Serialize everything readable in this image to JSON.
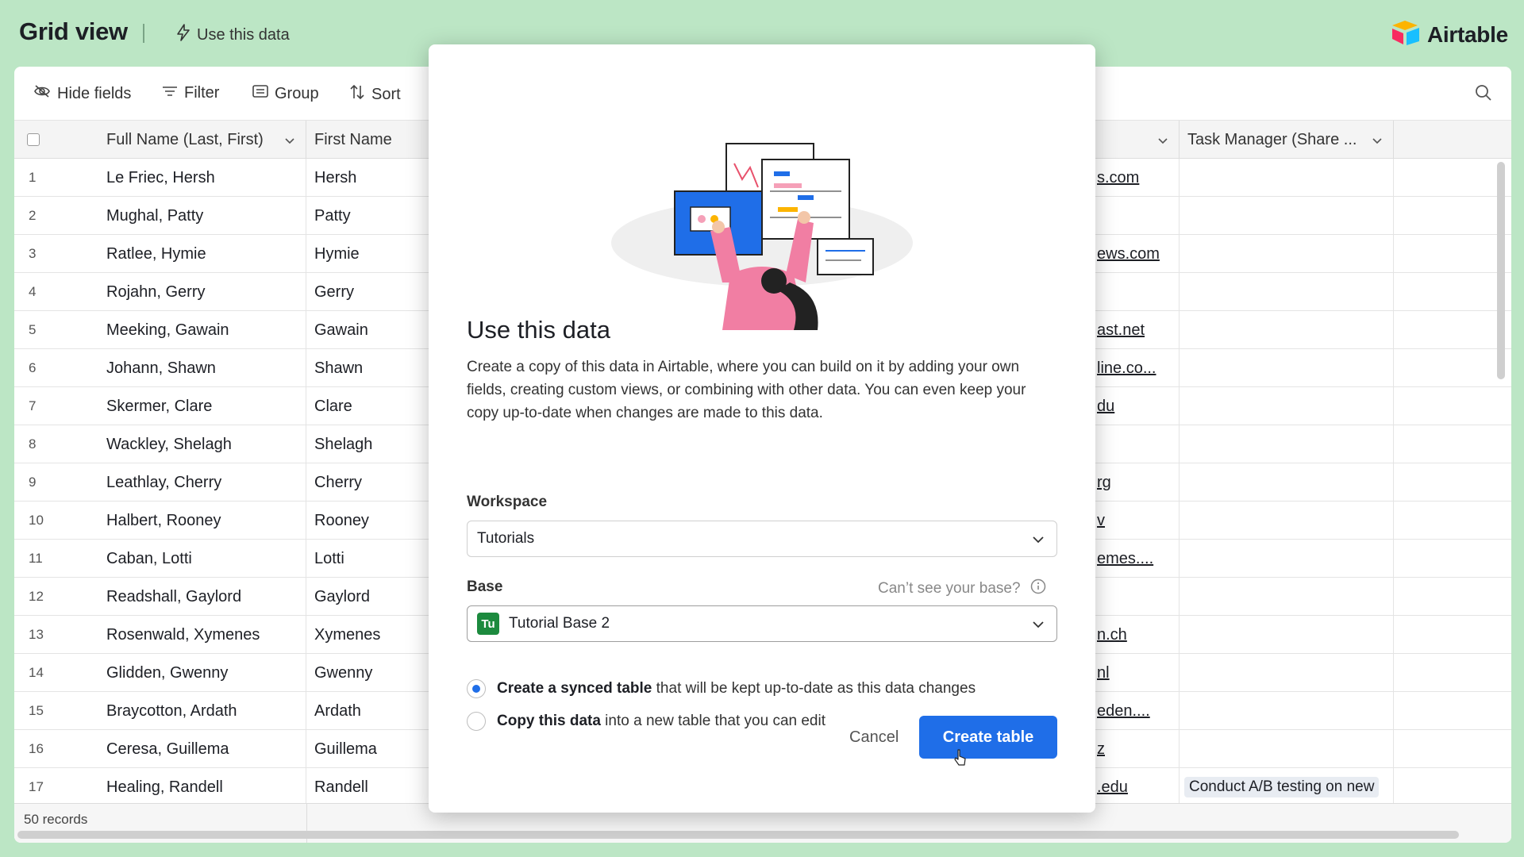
{
  "header": {
    "view_title": "Grid view",
    "use_data_label": "Use this data",
    "logo_text": "Airtable"
  },
  "toolbar": {
    "hide_fields": "Hide fields",
    "filter": "Filter",
    "group": "Group",
    "sort": "Sort"
  },
  "columns": {
    "full_name": "Full Name (Last, First)",
    "first_name": "First Name",
    "task_manager": "Task Manager (Share ..."
  },
  "rows": [
    {
      "num": "1",
      "full": "Le Friec, Hersh",
      "first": "Hersh",
      "email": "s.com",
      "task": ""
    },
    {
      "num": "2",
      "full": "Mughal, Patty",
      "first": "Patty",
      "email": "",
      "task": ""
    },
    {
      "num": "3",
      "full": "Ratlee, Hymie",
      "first": "Hymie",
      "email": "ews.com",
      "task": ""
    },
    {
      "num": "4",
      "full": "Rojahn, Gerry",
      "first": "Gerry",
      "email": "",
      "task": ""
    },
    {
      "num": "5",
      "full": "Meeking, Gawain",
      "first": "Gawain",
      "email": "ast.net",
      "task": ""
    },
    {
      "num": "6",
      "full": "Johann, Shawn",
      "first": "Shawn",
      "email": "line.co...",
      "task": ""
    },
    {
      "num": "7",
      "full": "Skermer, Clare",
      "first": "Clare",
      "email": "du",
      "task": ""
    },
    {
      "num": "8",
      "full": "Wackley, Shelagh",
      "first": "Shelagh",
      "email": "",
      "task": ""
    },
    {
      "num": "9",
      "full": "Leathlay, Cherry",
      "first": "Cherry",
      "email": "rg",
      "task": ""
    },
    {
      "num": "10",
      "full": "Halbert, Rooney",
      "first": "Rooney",
      "email": "v",
      "task": ""
    },
    {
      "num": "11",
      "full": "Caban, Lotti",
      "first": "Lotti",
      "email": "emes....",
      "task": ""
    },
    {
      "num": "12",
      "full": "Readshall, Gaylord",
      "first": "Gaylord",
      "email": "",
      "task": ""
    },
    {
      "num": "13",
      "full": "Rosenwald, Xymenes",
      "first": "Xymenes",
      "email": "n.ch",
      "task": ""
    },
    {
      "num": "14",
      "full": "Glidden, Gwenny",
      "first": "Gwenny",
      "email": "nl",
      "task": ""
    },
    {
      "num": "15",
      "full": "Braycotton, Ardath",
      "first": "Ardath",
      "email": "eden....",
      "task": ""
    },
    {
      "num": "16",
      "full": "Ceresa, Guillema",
      "first": "Guillema",
      "email": "z",
      "task": ""
    },
    {
      "num": "17",
      "full": "Healing, Randell",
      "first": "Randell",
      "email": ".edu",
      "task": "Conduct A/B testing on new"
    }
  ],
  "footer": {
    "record_count": "50 records"
  },
  "modal": {
    "title": "Use this data",
    "description": "Create a copy of this data in Airtable, where you can build on it by adding your own fields, creating custom views, or combining with other data. You can even keep your copy up-to-date when changes are made to this data.",
    "workspace_label": "Workspace",
    "workspace_value": "Tutorials",
    "base_label": "Base",
    "base_help": "Can’t see your base?",
    "base_badge": "Tu",
    "base_value": "Tutorial Base 2",
    "option_sync_bold": "Create a synced table",
    "option_sync_rest": " that will be kept up-to-date as this data changes",
    "option_copy_bold": "Copy this data",
    "option_copy_rest": " into a new table that you can edit",
    "cancel_label": "Cancel",
    "create_label": "Create table"
  },
  "colors": {
    "background": "#bce6c5",
    "primary": "#1f6ee8",
    "base_badge": "#1c8a3e"
  }
}
